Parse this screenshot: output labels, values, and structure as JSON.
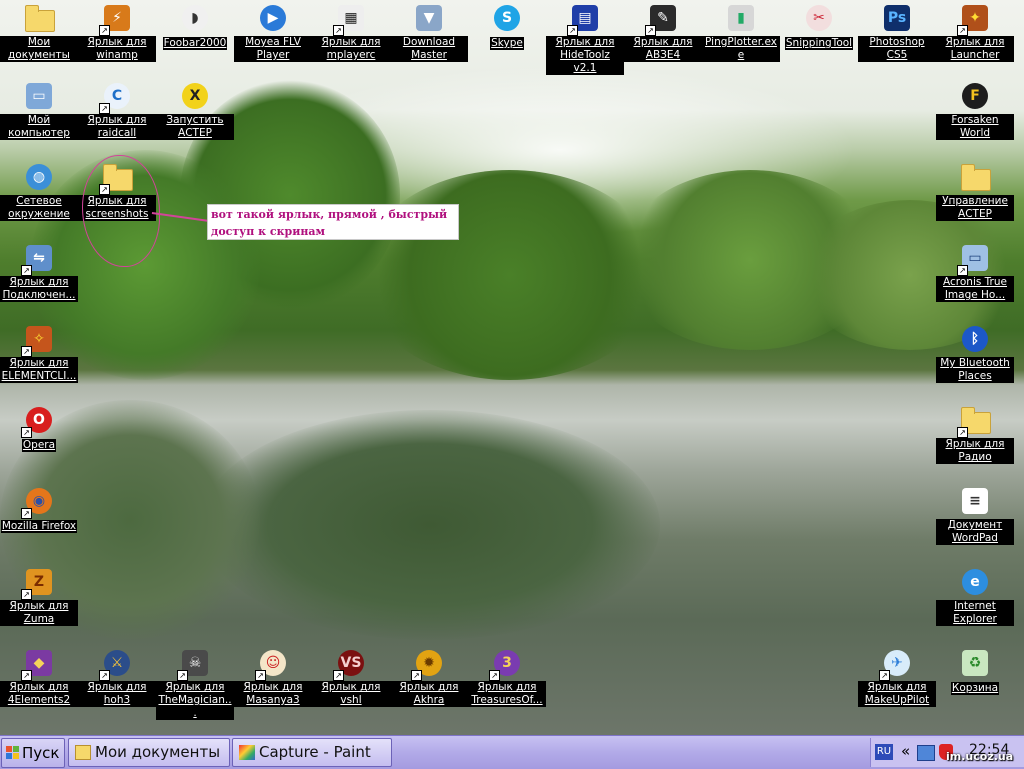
{
  "desktop_icons": {
    "top": [
      {
        "label": "Мои документы",
        "icon": "my-documents-icon",
        "shortcut": false
      },
      {
        "label": "Ярлык для winamp",
        "icon": "winamp-icon",
        "shortcut": true
      },
      {
        "label": "Foobar2000",
        "icon": "foobar-icon",
        "shortcut": false
      },
      {
        "label": "Moyea FLV Player",
        "icon": "flv-player-icon",
        "shortcut": false
      },
      {
        "label": "Ярлык для mplayerc",
        "icon": "mplayer-icon",
        "shortcut": true
      },
      {
        "label": "Download Master",
        "icon": "download-master-icon",
        "shortcut": false
      },
      {
        "label": "Skype",
        "icon": "skype-icon",
        "shortcut": false
      },
      {
        "label": "Ярлык для HideToolz v2.1",
        "icon": "hidetoolz-icon",
        "shortcut": true
      },
      {
        "label": "Ярлык для АВЗЕ4",
        "icon": "avz-icon",
        "shortcut": true
      },
      {
        "label": "PingPlotter.exe",
        "icon": "pingplotter-icon",
        "shortcut": false
      },
      {
        "label": "SnippingTool",
        "icon": "snipping-tool-icon",
        "shortcut": false
      },
      {
        "label": "Photoshop CS5",
        "icon": "photoshop-icon",
        "shortcut": false
      },
      {
        "label": "Ярлык для Launcher",
        "icon": "launcher-icon",
        "shortcut": true
      }
    ],
    "left": [
      {
        "label": "Мой компьютер",
        "icon": "my-computer-icon",
        "shortcut": false
      },
      {
        "label": "Ярлык для raidcall",
        "icon": "raidcall-icon",
        "shortcut": true
      },
      {
        "label": "Запустить АСТЕР",
        "icon": "aster-icon",
        "shortcut": false
      },
      {
        "label": "Сетевое окружение",
        "icon": "network-icon",
        "shortcut": false
      },
      {
        "label": "Ярлык для screenshots",
        "icon": "folder-icon",
        "shortcut": true
      },
      {
        "label": "Ярлык для Подключен...",
        "icon": "connection-icon",
        "shortcut": true
      },
      {
        "label": "Ярлык для ELEMENTCLI...",
        "icon": "element-client-icon",
        "shortcut": true
      },
      {
        "label": "Opera",
        "icon": "opera-icon",
        "shortcut": true
      },
      {
        "label": "Mozilla Firefox",
        "icon": "firefox-icon",
        "shortcut": true
      },
      {
        "label": "Ярлык для Zuma",
        "icon": "zuma-icon",
        "shortcut": true
      }
    ],
    "right": [
      {
        "label": "Forsaken World",
        "icon": "forsaken-world-icon",
        "shortcut": false
      },
      {
        "label": "Управление АСТЕР",
        "icon": "folder-icon",
        "shortcut": false
      },
      {
        "label": "Acronis True Image Ho...",
        "icon": "acronis-icon",
        "shortcut": true
      },
      {
        "label": "My Bluetooth Places",
        "icon": "bluetooth-icon",
        "shortcut": false
      },
      {
        "label": "Ярлык для Радио",
        "icon": "folder-icon",
        "shortcut": true
      },
      {
        "label": "Документ WordPad",
        "icon": "wordpad-document-icon",
        "shortcut": false
      },
      {
        "label": "Internet Explorer",
        "icon": "internet-explorer-icon",
        "shortcut": false
      },
      {
        "label": "Ярлык для MakeUpPilot",
        "icon": "makeuppilot-icon",
        "shortcut": true
      },
      {
        "label": "Корзина",
        "icon": "recycle-bin-icon",
        "shortcut": false
      }
    ],
    "bottom": [
      {
        "label": "Ярлык для 4Elements2",
        "icon": "4elements-icon",
        "shortcut": true
      },
      {
        "label": "Ярлык для hoh3",
        "icon": "hoh3-icon",
        "shortcut": true
      },
      {
        "label": "Ярлык для TheMagician...",
        "icon": "magician-icon",
        "shortcut": true
      },
      {
        "label": "Ярлык для Masanya3",
        "icon": "masyanya-icon",
        "shortcut": true
      },
      {
        "label": "Ярлык для vshl",
        "icon": "vshl-icon",
        "shortcut": true
      },
      {
        "label": "Ярлык для Akhra",
        "icon": "akhra-icon",
        "shortcut": true
      },
      {
        "label": "Ярлык для TreasuresOf...",
        "icon": "treasures-icon",
        "shortcut": true
      }
    ]
  },
  "annotation": {
    "text": "вот такой ярлык, прямой , быстрый доступ к скринам",
    "color": "#b0107e"
  },
  "taskbar": {
    "start_label": "Пуск",
    "tasks": [
      {
        "label": "Мои документы",
        "icon": "folder-icon"
      },
      {
        "label": "Capture - Paint",
        "icon": "paint-icon"
      }
    ],
    "tray": {
      "language": "RU",
      "chevron": "«",
      "clock": "22:54"
    }
  },
  "watermark": "im.ucoz.ua"
}
